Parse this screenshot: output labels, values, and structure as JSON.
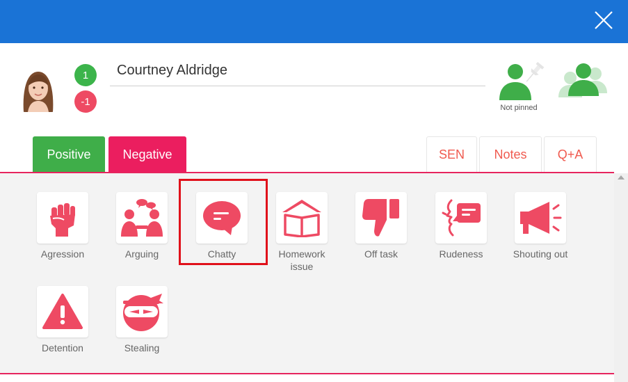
{
  "student": {
    "name": "Courtney Aldridge",
    "positive_points": "1",
    "negative_points": "-1",
    "pin_status": "Not pinned"
  },
  "tabs": {
    "positive": "Positive",
    "negative": "Negative",
    "sen": "SEN",
    "notes": "Notes",
    "qa": "Q+A"
  },
  "behaviours": [
    {
      "label": "Agression",
      "icon": "raised-fist-icon"
    },
    {
      "label": "Arguing",
      "icon": "people-arguing-icon"
    },
    {
      "label": "Chatty",
      "icon": "speech-bubble-icon"
    },
    {
      "label": "Homework issue",
      "icon": "open-book-icon"
    },
    {
      "label": "Off task",
      "icon": "thumbs-down-icon"
    },
    {
      "label": "Rudeness",
      "icon": "face-speech-icon"
    },
    {
      "label": "Shouting out",
      "icon": "megaphone-icon"
    },
    {
      "label": "Detention",
      "icon": "warning-icon"
    },
    {
      "label": "Stealing",
      "icon": "ninja-icon"
    }
  ],
  "colors": {
    "header": "#1a73d6",
    "positive": "#3fae49",
    "negative": "#eb1e5f",
    "icon_red": "#ee4a63",
    "accent_text": "#f05a4f",
    "highlight": "#e0101a"
  }
}
